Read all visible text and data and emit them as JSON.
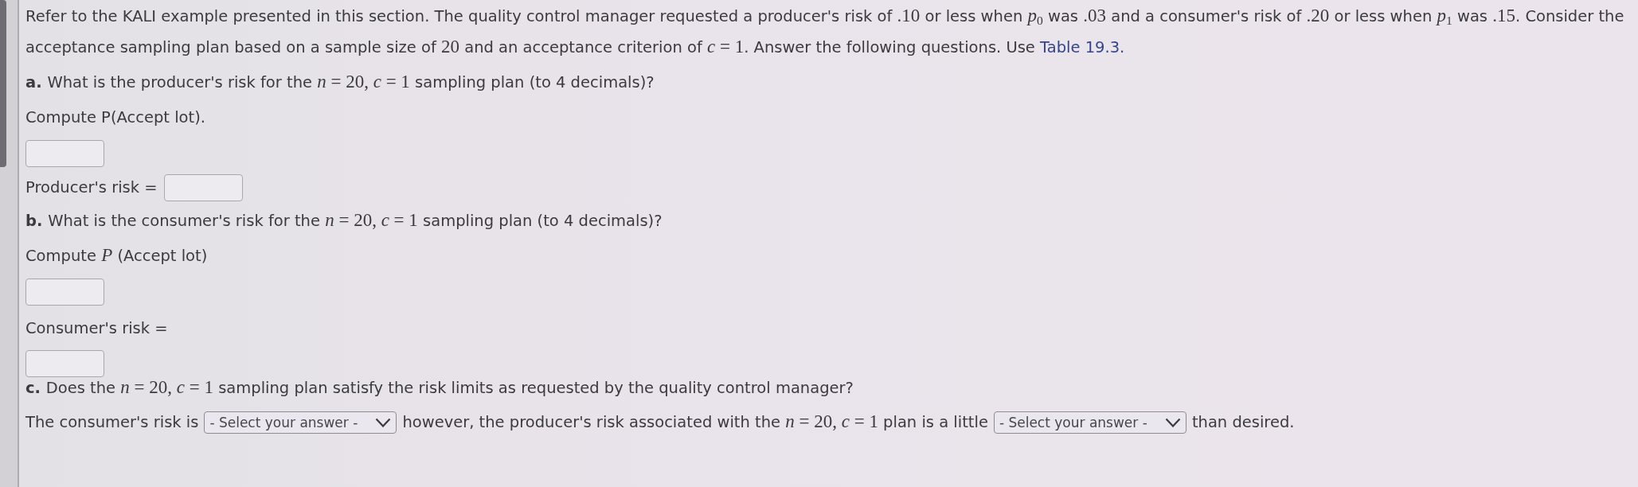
{
  "intro": {
    "parts": [
      {
        "kind": "text",
        "text": "Refer to the KALI example presented in this section. The quality control manager requested a producer's risk of "
      },
      {
        "kind": "math",
        "text": ".10"
      },
      {
        "kind": "text",
        "text": " or less when "
      },
      {
        "kind": "math",
        "text": "*p*$_{0}$"
      },
      {
        "kind": "text",
        "text": " was "
      },
      {
        "kind": "math",
        "text": ".03"
      },
      {
        "kind": "text",
        "text": " and a consumer's risk of "
      },
      {
        "kind": "math",
        "text": ".20"
      },
      {
        "kind": "text",
        "text": " or less when "
      },
      {
        "kind": "math",
        "text": "*p*$_{1}$"
      },
      {
        "kind": "text",
        "text": " was "
      },
      {
        "kind": "math",
        "text": ".15"
      },
      {
        "kind": "text",
        "text": ". Consider the acceptance sampling plan based on a sample size of "
      },
      {
        "kind": "math",
        "text": "20"
      },
      {
        "kind": "text",
        "text": " and an acceptance criterion of "
      },
      {
        "kind": "math",
        "text": "*c* = 1"
      },
      {
        "kind": "text",
        "text": ". Answer the following questions. Use "
      },
      {
        "kind": "link",
        "text": "Table 19.3."
      }
    ]
  },
  "sections": [
    {
      "label": "a.",
      "question": [
        {
          "kind": "text",
          "text": "What is the producer's risk for the "
        },
        {
          "kind": "math",
          "text": "*n* = 20, *c* = 1"
        },
        {
          "kind": "text",
          "text": " sampling plan (to 4 decimals)?"
        }
      ],
      "items": [
        {
          "kind": "paragraph",
          "parts": [
            {
              "kind": "text",
              "text": "Compute P(Accept lot)."
            }
          ]
        },
        {
          "kind": "answer_box"
        },
        {
          "kind": "labeled_box",
          "label": "Producer's risk ="
        }
      ]
    },
    {
      "label": "b.",
      "question": [
        {
          "kind": "text",
          "text": "What is the consumer's risk for the "
        },
        {
          "kind": "math",
          "text": "*n* = 20, *c* = 1"
        },
        {
          "kind": "text",
          "text": " sampling plan (to 4 decimals)?"
        }
      ],
      "items": [
        {
          "kind": "paragraph",
          "parts": [
            {
              "kind": "text",
              "text": "Compute "
            },
            {
              "kind": "math",
              "text": "*P*"
            },
            {
              "kind": "text",
              "text": " (Accept lot)"
            }
          ]
        },
        {
          "kind": "answer_box"
        },
        {
          "kind": "paragraph",
          "parts": [
            {
              "kind": "text",
              "text": "Consumer's risk ="
            }
          ]
        },
        {
          "kind": "answer_box"
        }
      ]
    },
    {
      "label": "c.",
      "question": [
        {
          "kind": "text",
          "text": "Does the "
        },
        {
          "kind": "math",
          "text": "*n* = 20, *c* = 1"
        },
        {
          "kind": "text",
          "text": " sampling plan satisfy the risk limits as requested by the quality control manager?"
        }
      ],
      "items": [
        {
          "kind": "choice_row",
          "parts": [
            {
              "kind": "text",
              "parts": [
                {
                  "kind": "text",
                  "text": "The consumer's risk is"
                }
              ]
            },
            {
              "kind": "dropdown",
              "placeholder": "- Select your answer -"
            },
            {
              "kind": "text",
              "parts": [
                {
                  "kind": "text",
                  "text": "however, the producer's risk associated with the "
                },
                {
                  "kind": "math",
                  "text": "*n* = 20, *c* = 1"
                },
                {
                  "kind": "text",
                  "text": " plan is a little"
                }
              ]
            },
            {
              "kind": "dropdown",
              "placeholder": "- Select your answer -"
            },
            {
              "kind": "text",
              "parts": [
                {
                  "kind": "text",
                  "text": "than desired."
                }
              ]
            }
          ]
        }
      ]
    }
  ]
}
